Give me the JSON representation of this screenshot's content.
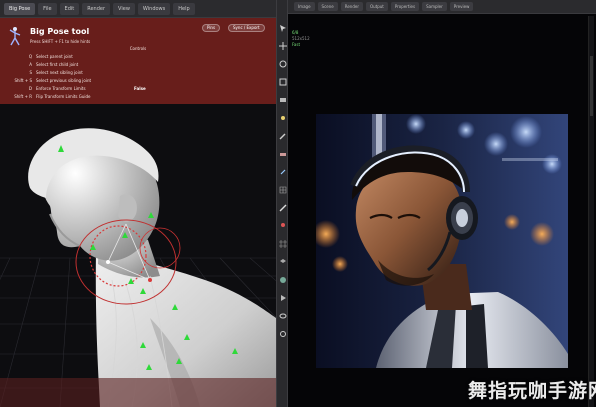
{
  "left_tabs": [
    "Big Pose",
    "File",
    "Edit",
    "Render",
    "View",
    "Windows",
    "Help"
  ],
  "big_pose": {
    "title": "Big Pose tool",
    "hint": "Press SHIFT + F1 to hide hints",
    "controls_label": "Controls",
    "pins_button": "Pins",
    "export_button": "Sync / Export",
    "controls": [
      {
        "key": "Q",
        "desc": "Select parent joint",
        "value": ""
      },
      {
        "key": "A",
        "desc": "Select first child joint",
        "value": ""
      },
      {
        "key": "S",
        "desc": "Select next sibling joint",
        "value": ""
      },
      {
        "key": "Shift + S",
        "desc": "Select previous sibling joint",
        "value": ""
      },
      {
        "key": "D",
        "desc": "Enforce Transform Limits",
        "value": "False"
      },
      {
        "key": "Shift + R",
        "desc": "Flip Transform Limits Guide",
        "value": ""
      }
    ]
  },
  "right_tabs": [
    "Image",
    "Scene",
    "Render",
    "Output",
    "Properties",
    "Sampler",
    "Preview"
  ],
  "right_info": [
    "6/8",
    "512x512",
    "Fast"
  ],
  "tool_icons": [
    "select-icon",
    "move-icon",
    "rotate-icon",
    "scale-icon",
    "camera-icon",
    "light-icon",
    "brush-icon",
    "eraser-icon",
    "picker-icon",
    "mesh-icon",
    "bone-icon",
    "pin-icon",
    "grid-icon",
    "layers-icon",
    "material-icon",
    "render-icon",
    "eye-icon",
    "settings-icon"
  ],
  "watermark": "舞指玩咖手游网",
  "colors": {
    "panel_red": "#701c1a",
    "viewport_bg": "#0d0d10",
    "gizmo_green": "#2fd93a",
    "gizmo_red": "#d83a3a"
  }
}
